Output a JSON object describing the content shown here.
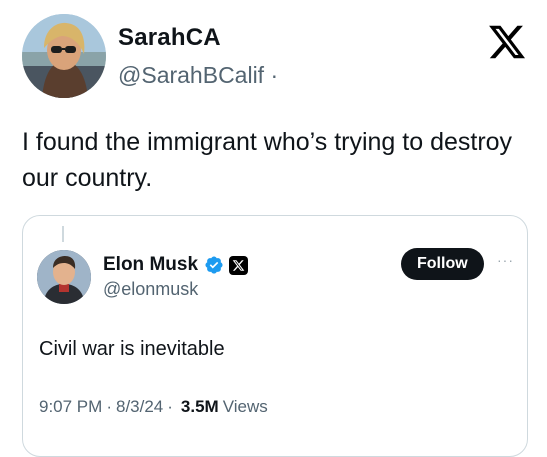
{
  "post": {
    "author_name": "SarahCA",
    "author_handle": "@SarahBCalif",
    "handle_separator": "·",
    "text": "I found the immigrant who’s trying to destroy our country."
  },
  "quoted_post": {
    "author_name": "Elon Musk",
    "author_handle": "@elonmusk",
    "follow_label": "Follow",
    "more_label": "···",
    "text": "Civil war is inevitable",
    "time": "9:07 PM",
    "date": "8/3/24",
    "meta_separator": "·",
    "views_count": "3.5M",
    "views_label": "Views"
  },
  "icons": {
    "brand": "x-logo-icon",
    "verified": "verified-badge-icon",
    "affiliation": "x-affiliate-badge-icon",
    "more": "more-options-icon"
  },
  "colors": {
    "text_primary": "#0f1419",
    "text_secondary": "#536471",
    "verified_blue": "#1d9bf0",
    "border": "#cfd9de",
    "button_bg": "#0f1419"
  }
}
